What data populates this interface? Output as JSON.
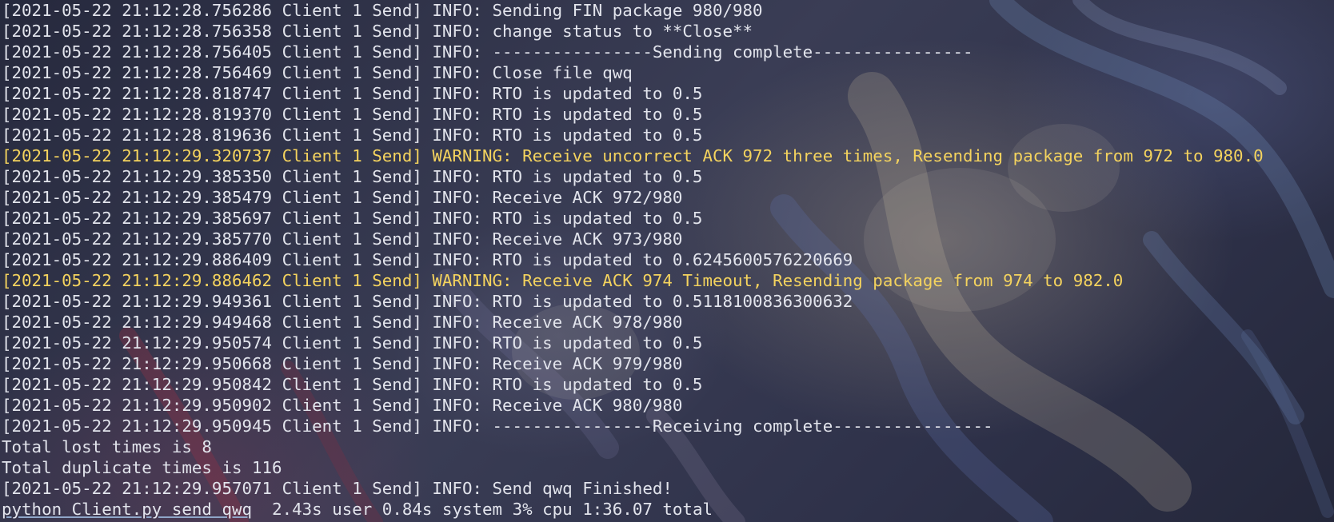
{
  "colors": {
    "text": "#e2e4ec",
    "warning": "#f4d35e",
    "background": "#2b2f47"
  },
  "log_lines": [
    {
      "level": "info",
      "text": "[2021-05-22 21:12:28.756286 Client 1 Send] INFO: Sending FIN package 980/980"
    },
    {
      "level": "info",
      "text": "[2021-05-22 21:12:28.756358 Client 1 Send] INFO: change status to **Close**"
    },
    {
      "level": "info",
      "text": "[2021-05-22 21:12:28.756405 Client 1 Send] INFO: ----------------Sending complete----------------"
    },
    {
      "level": "info",
      "text": "[2021-05-22 21:12:28.756469 Client 1 Send] INFO: Close file qwq"
    },
    {
      "level": "info",
      "text": "[2021-05-22 21:12:28.818747 Client 1 Send] INFO: RTO is updated to 0.5"
    },
    {
      "level": "info",
      "text": "[2021-05-22 21:12:28.819370 Client 1 Send] INFO: RTO is updated to 0.5"
    },
    {
      "level": "info",
      "text": "[2021-05-22 21:12:28.819636 Client 1 Send] INFO: RTO is updated to 0.5"
    },
    {
      "level": "warning",
      "text": "[2021-05-22 21:12:29.320737 Client 1 Send] WARNING: Receive uncorrect ACK 972 three times, Resending package from 972 to 980.0"
    },
    {
      "level": "info",
      "text": "[2021-05-22 21:12:29.385350 Client 1 Send] INFO: RTO is updated to 0.5"
    },
    {
      "level": "info",
      "text": "[2021-05-22 21:12:29.385479 Client 1 Send] INFO: Receive ACK 972/980"
    },
    {
      "level": "info",
      "text": "[2021-05-22 21:12:29.385697 Client 1 Send] INFO: RTO is updated to 0.5"
    },
    {
      "level": "info",
      "text": "[2021-05-22 21:12:29.385770 Client 1 Send] INFO: Receive ACK 973/980"
    },
    {
      "level": "info",
      "text": "[2021-05-22 21:12:29.886409 Client 1 Send] INFO: RTO is updated to 0.6245600576220669"
    },
    {
      "level": "warning",
      "text": "[2021-05-22 21:12:29.886462 Client 1 Send] WARNING: Receive ACK 974 Timeout, Resending package from 974 to 982.0"
    },
    {
      "level": "info",
      "text": "[2021-05-22 21:12:29.949361 Client 1 Send] INFO: RTO is updated to 0.5118100836300632"
    },
    {
      "level": "info",
      "text": "[2021-05-22 21:12:29.949468 Client 1 Send] INFO: Receive ACK 978/980"
    },
    {
      "level": "info",
      "text": "[2021-05-22 21:12:29.950574 Client 1 Send] INFO: RTO is updated to 0.5"
    },
    {
      "level": "info",
      "text": "[2021-05-22 21:12:29.950668 Client 1 Send] INFO: Receive ACK 979/980"
    },
    {
      "level": "info",
      "text": "[2021-05-22 21:12:29.950842 Client 1 Send] INFO: RTO is updated to 0.5"
    },
    {
      "level": "info",
      "text": "[2021-05-22 21:12:29.950902 Client 1 Send] INFO: Receive ACK 980/980"
    },
    {
      "level": "info",
      "text": "[2021-05-22 21:12:29.950945 Client 1 Send] INFO: ----------------Receiving complete----------------"
    },
    {
      "level": "plain",
      "text": "Total lost times is 8"
    },
    {
      "level": "plain",
      "text": "Total duplicate times is 116"
    },
    {
      "level": "info",
      "text": "[2021-05-22 21:12:29.957071 Client 1 Send] INFO: Send qwq Finished!"
    }
  ],
  "prompt_line": {
    "command": "python Client.py send qwq",
    "timing": "  2.43s user 0.84s system 3% cpu 1:36.07 total"
  }
}
